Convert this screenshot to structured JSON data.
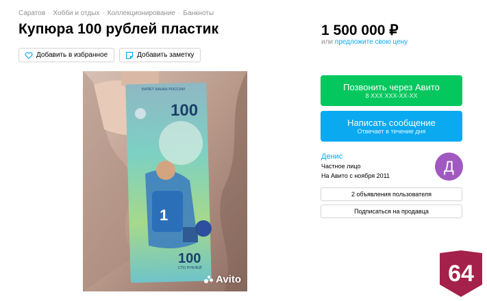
{
  "breadcrumbs": [
    "Саратов",
    "Хобби и отдых",
    "Коллекционирование",
    "Банкноты"
  ],
  "title": "Купюра 100 рублей пластик",
  "actions": {
    "favorite_label": "Добавить в избранное",
    "note_label": "Добавить заметку"
  },
  "price": {
    "value": "1 500 000 ₽",
    "or_text": "или",
    "offer_link": "предложите свою цену"
  },
  "call_button": {
    "label": "Позвонить через Авито",
    "phone": "8 XXX XXX-XX-XX",
    "color": "#04c75e"
  },
  "message_button": {
    "label": "Написать сообщение",
    "sub": "Отвечает в течение дня",
    "color": "#0aa9f0"
  },
  "seller": {
    "name": "Денис",
    "type": "Частное лицо",
    "since": "На Авито с ноября 2011",
    "avatar_letter": "Д",
    "avatar_color": "#a05abf",
    "listings_button": "2 объявления пользователя",
    "subscribe_button": "Подписаться на продавца"
  },
  "photo": {
    "banknote_top_text": "БИЛЕТ БАНКА РОССИИ",
    "banknote_denomination": "100",
    "banknote_bottom_text": "СТО РУБЛЕЙ",
    "watermark": "Avito"
  },
  "badge": {
    "text": "64",
    "color": "#a3214a"
  },
  "icons": {
    "favorite": "heart-icon",
    "note": "note-icon"
  }
}
